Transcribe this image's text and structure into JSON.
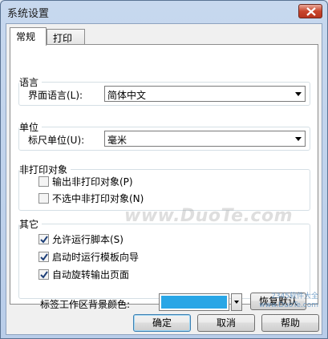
{
  "window": {
    "title": "系统设置"
  },
  "tabs": [
    {
      "label": "常规",
      "active": true
    },
    {
      "label": "打印",
      "active": false
    }
  ],
  "language_group": {
    "title": "语言",
    "ui_language_label": "界面语言(L):",
    "ui_language_value": "简体中文"
  },
  "unit_group": {
    "title": "单位",
    "ruler_unit_label": "标尺单位(U):",
    "ruler_unit_value": "毫米"
  },
  "non_print_group": {
    "title": "非打印对象",
    "items": [
      {
        "label": "输出非打印对象(P)",
        "checked": false
      },
      {
        "label": "不选中非打印对象(N)",
        "checked": false
      }
    ]
  },
  "other_group": {
    "title": "其它",
    "items": [
      {
        "label": "允许运行脚本(S)",
        "checked": true
      },
      {
        "label": "启动时运行模板向导",
        "checked": true
      },
      {
        "label": "自动旋转输出页面",
        "checked": true
      }
    ],
    "bg_color_label": "标签工作区背景颜色:",
    "bg_color": "#29a6e6",
    "restore_default_label": "恢复默认"
  },
  "buttons": {
    "ok": "确定",
    "cancel": "取消",
    "help": "帮助"
  },
  "watermark": {
    "text": "www.DuoTe.com",
    "corner_line1": "2345软件大全",
    "corner_line2": "www.DuoTe.com"
  }
}
